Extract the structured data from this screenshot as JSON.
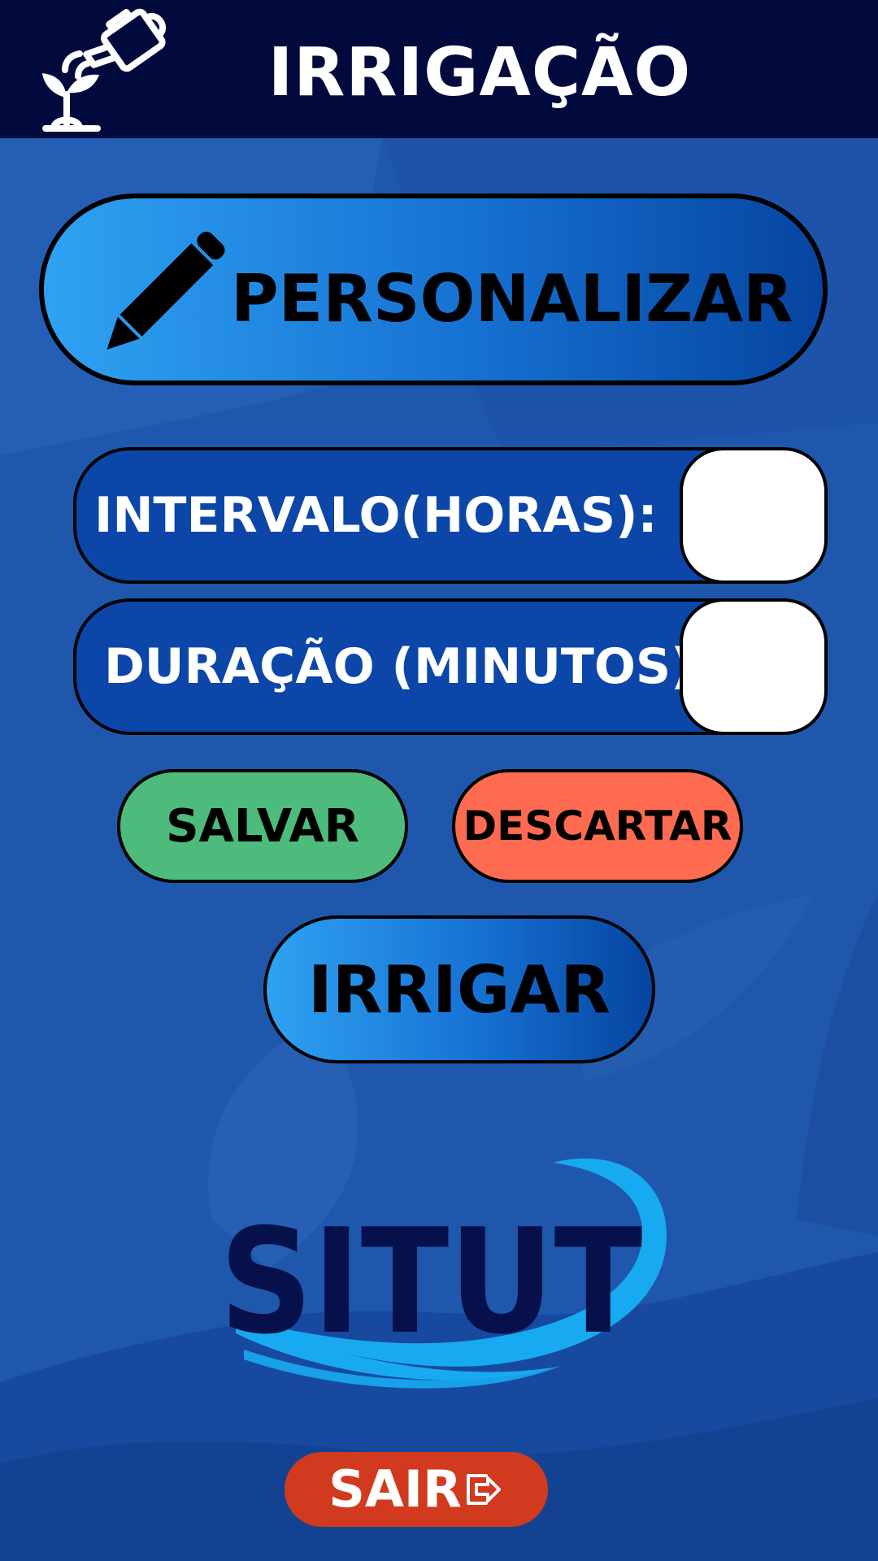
{
  "header": {
    "title": "IRRIGAÇÃO",
    "icon": "watering-can-plant-icon"
  },
  "customize": {
    "label": "PERSONALIZAR",
    "icon": "pencil-icon"
  },
  "fields": {
    "interval": {
      "label": "INTERVALO(HORAS):",
      "value": ""
    },
    "duration": {
      "label": "DURAÇÃO (MINUTOS):",
      "value": ""
    }
  },
  "actions": {
    "save_label": "SALVAR",
    "discard_label": "DESCARTAR",
    "irrigate_label": "IRRIGAR",
    "exit_label": "SAIR",
    "exit_icon": "logout-icon"
  },
  "logo": {
    "text": "SITUT"
  },
  "colors": {
    "header_bg": "#020a3d",
    "background": "#1f57ad",
    "save": "#4dbb7b",
    "discard": "#ff6b50",
    "exit": "#d23a1f",
    "logo_dark": "#06104a",
    "logo_wave": "#18aaf0"
  }
}
